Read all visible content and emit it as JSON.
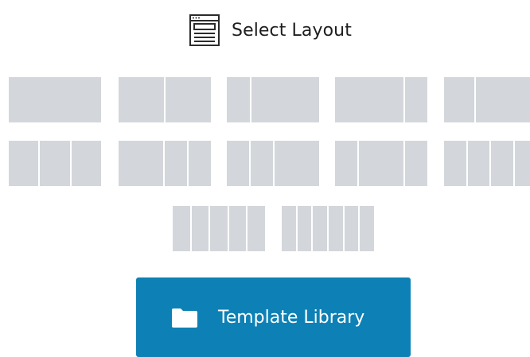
{
  "header": {
    "title": "Select Layout",
    "icon": "layout-template-icon"
  },
  "layouts": [
    {
      "name": "layout-1-col",
      "columns": [
        1
      ]
    },
    {
      "name": "layout-2-col",
      "columns": [
        1,
        1
      ]
    },
    {
      "name": "layout-1-3-col",
      "columns": [
        1,
        3
      ]
    },
    {
      "name": "layout-3-1-col",
      "columns": [
        3,
        1
      ]
    },
    {
      "name": "layout-1-2-col",
      "columns": [
        1,
        2
      ]
    },
    {
      "name": "layout-3-col",
      "columns": [
        1,
        1,
        1
      ]
    },
    {
      "name": "layout-2-1-1-col",
      "columns": [
        2,
        1,
        1
      ]
    },
    {
      "name": "layout-1-1-2-col",
      "columns": [
        1,
        1,
        2
      ]
    },
    {
      "name": "layout-1-2-1-col",
      "columns": [
        1,
        2,
        1
      ]
    },
    {
      "name": "layout-4-col",
      "columns": [
        1,
        1,
        1,
        1
      ]
    },
    {
      "name": "layout-5-col",
      "columns": [
        1,
        1,
        1,
        1,
        1
      ]
    },
    {
      "name": "layout-6-col",
      "columns": [
        1,
        1,
        1,
        1,
        1,
        1
      ]
    }
  ],
  "template_button": {
    "label": "Template Library",
    "icon": "folder-icon"
  },
  "colors": {
    "tile": "#d3d7db",
    "button": "#0d81b5",
    "button_text": "#ffffff",
    "title_text": "#1e1e1e"
  }
}
